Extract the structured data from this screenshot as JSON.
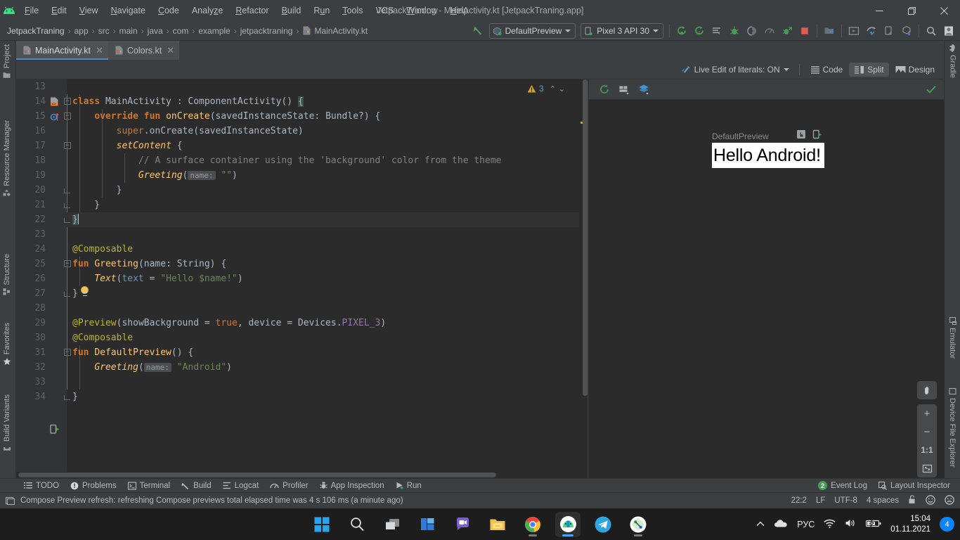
{
  "window": {
    "title": "JetpackTraning - MainActivity.kt [JetpackTraning.app]",
    "minimize": "–",
    "maximize": "❐",
    "close": "✕"
  },
  "menu": {
    "items": [
      "File",
      "Edit",
      "View",
      "Navigate",
      "Code",
      "Analyze",
      "Refactor",
      "Build",
      "Run",
      "Tools",
      "VCS",
      "Window",
      "Help"
    ]
  },
  "breadcrumb": {
    "items": [
      "JetpackTraning",
      "app",
      "src",
      "main",
      "java",
      "com",
      "example",
      "jetpacktraning"
    ],
    "file": "MainActivity.kt",
    "separator": "›"
  },
  "toolbar": {
    "run_config": "DefaultPreview",
    "device": "Pixel 3 API 30",
    "icons": [
      "run-icon",
      "run-coverage-icon",
      "apply-changes-icon",
      "debug-icon",
      "attach-debugger-icon",
      "profiler-icon",
      "profile-app-icon",
      "stop-icon",
      "sdk-manager-icon",
      "avd-manager-icon",
      "sync-gradle-icon",
      "device-manager-icon",
      "device-explorer-icon",
      "search-icon",
      "account-icon"
    ]
  },
  "editor_tabs": [
    {
      "label": "MainActivity.kt",
      "active": true,
      "close": "✕"
    },
    {
      "label": "Colors.kt",
      "active": false,
      "close": "✕"
    }
  ],
  "editor_header": {
    "live_edit": "Live Edit of literals: ON",
    "modes": [
      {
        "label": "Code",
        "selected": false
      },
      {
        "label": "Split",
        "selected": true
      },
      {
        "label": "Design",
        "selected": false
      }
    ]
  },
  "inspection": {
    "warning_count": "3",
    "up_arrow": "⌃",
    "down_arrow": "⌄"
  },
  "code": {
    "first_line_number": 13,
    "lines": [
      {
        "n": 13,
        "segments": []
      },
      {
        "n": 14,
        "fold": "open",
        "gutter": "class-marker",
        "segments": [
          {
            "t": "class ",
            "c": "kwb"
          },
          {
            "t": "MainActivity ",
            "c": "cls"
          },
          {
            "t": ": ",
            "c": "cls"
          },
          {
            "t": "ComponentActivity() ",
            "c": "cls"
          },
          {
            "t": "{",
            "c": "brace-hl"
          }
        ]
      },
      {
        "n": 15,
        "fold": "open",
        "gutter": "override-marker",
        "indent": 1,
        "segments": [
          {
            "t": "    ",
            "c": ""
          },
          {
            "t": "override ",
            "c": "kwb"
          },
          {
            "t": "fun ",
            "c": "kwb"
          },
          {
            "t": "onCreate",
            "c": "fn"
          },
          {
            "t": "(savedInstanceState: Bundle?) {",
            "c": "cls"
          }
        ]
      },
      {
        "n": 16,
        "indent": 2,
        "segments": [
          {
            "t": "        ",
            "c": ""
          },
          {
            "t": "super",
            "c": "kw"
          },
          {
            "t": ".onCreate(savedInstanceState)",
            "c": "cls"
          }
        ]
      },
      {
        "n": 17,
        "fold": "open",
        "indent": 2,
        "segments": [
          {
            "t": "        ",
            "c": ""
          },
          {
            "t": "setContent ",
            "c": "fni"
          },
          {
            "t": "{",
            "c": "cls"
          }
        ]
      },
      {
        "n": 18,
        "indent": 3,
        "segments": [
          {
            "t": "            ",
            "c": ""
          },
          {
            "t": "// A surface container using the 'background' color from the theme",
            "c": "cmt"
          }
        ]
      },
      {
        "n": 19,
        "indent": 3,
        "segments": [
          {
            "t": "            ",
            "c": ""
          },
          {
            "t": "Greeting",
            "c": "fni"
          },
          {
            "t": "(",
            "c": "cls"
          },
          {
            "t": "name:",
            "c": "hint"
          },
          {
            "t": " ",
            "c": ""
          },
          {
            "t": "\"\"",
            "c": "str"
          },
          {
            "t": ")",
            "c": "cls"
          }
        ]
      },
      {
        "n": 20,
        "fold": "close",
        "indent": 2,
        "segments": [
          {
            "t": "        }",
            "c": "cls"
          }
        ]
      },
      {
        "n": 21,
        "fold": "close",
        "bulb": true,
        "indent": 1,
        "segments": [
          {
            "t": "    }",
            "c": "cls"
          }
        ]
      },
      {
        "n": 22,
        "fold": "close",
        "current": true,
        "segments": [
          {
            "t": "}",
            "c": "brace-hl"
          }
        ]
      },
      {
        "n": 23,
        "segments": []
      },
      {
        "n": 24,
        "segments": [
          {
            "t": "@Composable",
            "c": "ann"
          }
        ]
      },
      {
        "n": 25,
        "fold": "open",
        "segments": [
          {
            "t": "fun ",
            "c": "kwb"
          },
          {
            "t": "Greeting",
            "c": "fn"
          },
          {
            "t": "(name: String) {",
            "c": "cls"
          }
        ]
      },
      {
        "n": 26,
        "indent": 1,
        "segments": [
          {
            "t": "    ",
            "c": ""
          },
          {
            "t": "Text",
            "c": "fni"
          },
          {
            "t": "(",
            "c": "cls"
          },
          {
            "t": "text",
            "c": "num"
          },
          {
            "t": " = ",
            "c": "cls"
          },
          {
            "t": "\"Hello $name!\"",
            "c": "str"
          },
          {
            "t": ")",
            "c": "cls"
          }
        ]
      },
      {
        "n": 27,
        "fold": "close",
        "segments": [
          {
            "t": "}",
            "c": "cls"
          }
        ]
      },
      {
        "n": 28,
        "segments": []
      },
      {
        "n": 29,
        "segments": [
          {
            "t": "@Preview",
            "c": "ann"
          },
          {
            "t": "(showBackground = ",
            "c": "cls"
          },
          {
            "t": "true",
            "c": "kw"
          },
          {
            "t": ", device = Devices.",
            "c": "cls"
          },
          {
            "t": "PIXEL_3",
            "c": "const"
          },
          {
            "t": ")",
            "c": "cls"
          }
        ]
      },
      {
        "n": 30,
        "segments": [
          {
            "t": "@Composable",
            "c": "ann"
          }
        ]
      },
      {
        "n": 31,
        "fold": "open",
        "gutter": "run-preview-marker",
        "segments": [
          {
            "t": "fun ",
            "c": "kwb"
          },
          {
            "t": "DefaultPreview",
            "c": "fn"
          },
          {
            "t": "() {",
            "c": "cls"
          }
        ]
      },
      {
        "n": 32,
        "indent": 1,
        "segments": [
          {
            "t": "    ",
            "c": ""
          },
          {
            "t": "Greeting",
            "c": "fni"
          },
          {
            "t": "(",
            "c": "cls"
          },
          {
            "t": "name:",
            "c": "hint"
          },
          {
            "t": " ",
            "c": ""
          },
          {
            "t": "\"Android\"",
            "c": "str"
          },
          {
            "t": ")",
            "c": "cls"
          }
        ]
      },
      {
        "n": 33,
        "segments": []
      },
      {
        "n": 34,
        "fold": "close",
        "segments": [
          {
            "t": "}",
            "c": "cls"
          }
        ]
      }
    ]
  },
  "left_tool_strip": [
    {
      "label": "Project",
      "icon": "folder-icon"
    },
    {
      "label": "Resource Manager",
      "icon": "resource-icon"
    },
    {
      "label": "Structure",
      "icon": "structure-icon"
    },
    {
      "label": "Favorites",
      "icon": "star-icon"
    },
    {
      "label": "Build Variants",
      "icon": "variants-icon"
    }
  ],
  "right_tool_strip": [
    {
      "label": "Gradle",
      "icon": "gradle-elephant-icon"
    },
    {
      "label": "Emulator",
      "icon": "emulator-icon"
    },
    {
      "label": "Device File Explorer",
      "icon": "device-file-icon"
    }
  ],
  "preview": {
    "toolbar_icons": [
      "refresh-icon",
      "build-refresh-icon",
      "layers-icon"
    ],
    "status_icon": "check-icon",
    "name": "DefaultPreview",
    "item_icons": [
      "interactive-mode-icon",
      "deploy-preview-icon"
    ],
    "rendered_text": "Hello Android!",
    "zoom_controls": {
      "pan": "✋",
      "zoom_in": "+",
      "zoom_out": "−",
      "actual_size": "1:1",
      "fit_screen": "⛶"
    }
  },
  "bottom_tool_windows": [
    {
      "label": "TODO",
      "icon": "todo-icon"
    },
    {
      "label": "Problems",
      "icon": "problems-icon"
    },
    {
      "label": "Terminal",
      "icon": "terminal-icon"
    },
    {
      "label": "Build",
      "icon": "build-hammer-icon"
    },
    {
      "label": "Logcat",
      "icon": "logcat-icon"
    },
    {
      "label": "Profiler",
      "icon": "profiler-icon"
    },
    {
      "label": "App Inspection",
      "icon": "app-inspection-icon"
    },
    {
      "label": "Run",
      "icon": "run-play-icon"
    }
  ],
  "bottom_right": {
    "event_log_badge": "2",
    "event_log": "Event Log",
    "layout_inspector": "Layout Inspector"
  },
  "status_bar": {
    "message": "Compose Preview refresh: refreshing Compose previews total elapsed time was 4 s 106 ms (a minute ago)",
    "caret_position": "22:2",
    "line_separator": "LF",
    "encoding": "UTF-8",
    "indent": "4 spaces",
    "lock_icon": "read-write-lock-icon",
    "face_happy": "☺",
    "face_sad": "☹"
  },
  "taskbar": {
    "apps": [
      {
        "name": "start-windows-icon",
        "active": false,
        "running": false
      },
      {
        "name": "search-icon",
        "active": false,
        "running": false
      },
      {
        "name": "task-view-icon",
        "active": false,
        "running": false
      },
      {
        "name": "widgets-icon",
        "active": false,
        "running": false
      },
      {
        "name": "teams-chat-icon",
        "active": false,
        "running": false
      },
      {
        "name": "file-explorer-icon",
        "active": false,
        "running": false
      },
      {
        "name": "google-chrome-icon",
        "active": false,
        "running": true
      },
      {
        "name": "android-studio-icon",
        "active": true,
        "running": true
      },
      {
        "name": "telegram-icon",
        "active": false,
        "running": false
      },
      {
        "name": "sourcetree-icon",
        "active": false,
        "running": true
      }
    ],
    "tray": {
      "overflow": "⌃",
      "cloud_icon": "onedrive-icon",
      "language": "РУС",
      "wifi_icon": "wifi-icon",
      "volume_icon": "volume-icon",
      "battery_icon": "battery-charging-icon",
      "time": "15:04",
      "date": "01.11.2021",
      "notification_count": "4"
    }
  },
  "colors": {
    "accent_blue": "#4a88c7",
    "editor_bg": "#2b2b2b",
    "chrome_bg": "#3c3f41",
    "green": "#499c54",
    "string_green": "#6a8759",
    "keyword_orange": "#cc7832",
    "annotation_yellow": "#bbb529"
  }
}
